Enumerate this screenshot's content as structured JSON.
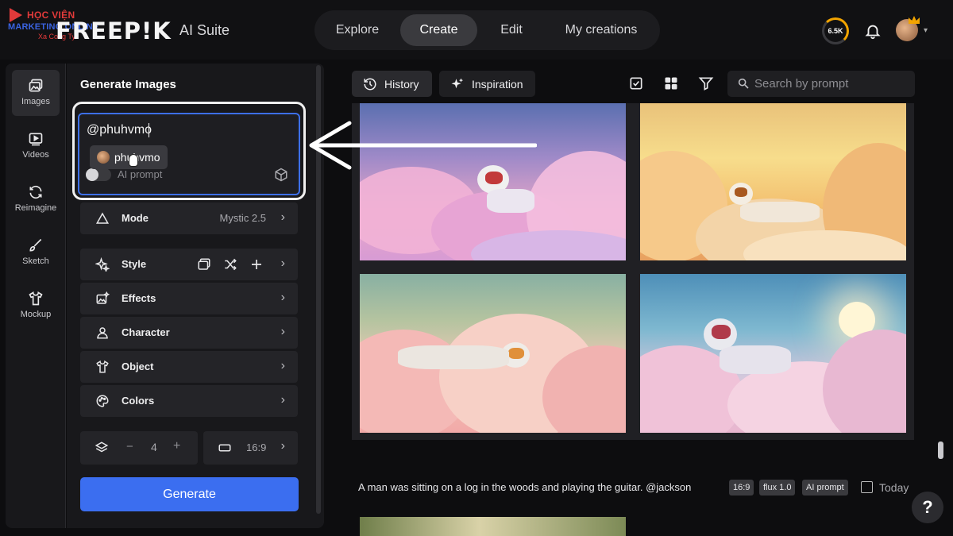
{
  "watermark": {
    "line1": "HỌC VIỆN",
    "line2": "MARKETING ONLINE",
    "line3": "Xa Cong Ty"
  },
  "brand": {
    "logo": "FREEP!K",
    "suite": "AI Suite"
  },
  "nav": {
    "tabs": [
      {
        "label": "Explore"
      },
      {
        "label": "Create"
      },
      {
        "label": "Edit"
      },
      {
        "label": "My creations"
      }
    ],
    "active": "Create"
  },
  "header": {
    "credits": "6.5K"
  },
  "rail": {
    "items": [
      {
        "label": "Images"
      },
      {
        "label": "Videos"
      },
      {
        "label": "Reimagine"
      },
      {
        "label": "Sketch"
      },
      {
        "label": "Mockup"
      }
    ]
  },
  "panel": {
    "title": "Generate Images",
    "prompt_value": "@phuhvmo",
    "mention_suggestion": "phuhvmo",
    "ai_prompt_label": "AI prompt",
    "mode": {
      "label": "Mode",
      "value": "Mystic 2.5"
    },
    "options": [
      {
        "label": "Style"
      },
      {
        "label": "Effects"
      },
      {
        "label": "Character"
      },
      {
        "label": "Object"
      },
      {
        "label": "Colors"
      }
    ],
    "quantity": {
      "minus": "−",
      "value": "4",
      "plus": "+"
    },
    "aspect_ratio": "16:9",
    "generate_label": "Generate"
  },
  "gallery": {
    "history_label": "History",
    "inspiration_label": "Inspiration",
    "search_placeholder": "Search by prompt",
    "caption": "A man was sitting on a log in the woods and playing the guitar. @jackson",
    "tags": [
      "16:9",
      "flux 1.0",
      "AI prompt"
    ],
    "date_label": "Today",
    "help_label": "?"
  },
  "colors": {
    "accent": "#3b6ef0",
    "credits_ring": "#f2a400",
    "panel_bg": "#18181b",
    "app_bg": "#0d0d0f"
  }
}
